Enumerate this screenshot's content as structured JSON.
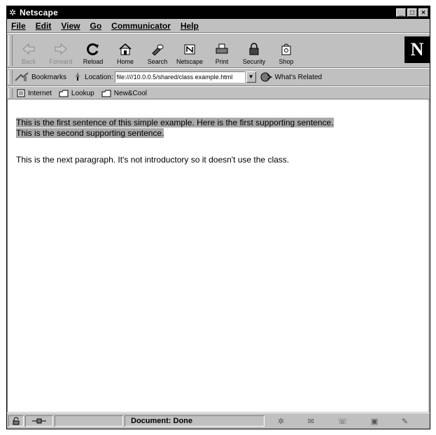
{
  "window": {
    "title": "Netscape"
  },
  "menu": [
    "File",
    "Edit",
    "View",
    "Go",
    "Communicator",
    "Help"
  ],
  "nav": {
    "back": "Back",
    "forward": "Forward",
    "reload": "Reload",
    "home": "Home",
    "search": "Search",
    "netscape": "Netscape",
    "print": "Print",
    "security": "Security",
    "shop": "Shop",
    "logo": "N"
  },
  "location": {
    "bookmarks_label": "Bookmarks",
    "location_label": "Location:",
    "url": "file:////10.0.0.5/shared/class example.html",
    "whats_related": "What's Related"
  },
  "personal": {
    "internet": "Internet",
    "lookup": "Lookup",
    "newcool": "New&Cool"
  },
  "content": {
    "para1_line1": "This is the first sentence of this simple example. Here is the first supporting sentence.",
    "para1_line2": "This is the second supporting sentence.",
    "para2": "This is the next paragraph. It's not introductory so it doesn't use the class."
  },
  "status": {
    "text": "Document: Done"
  }
}
